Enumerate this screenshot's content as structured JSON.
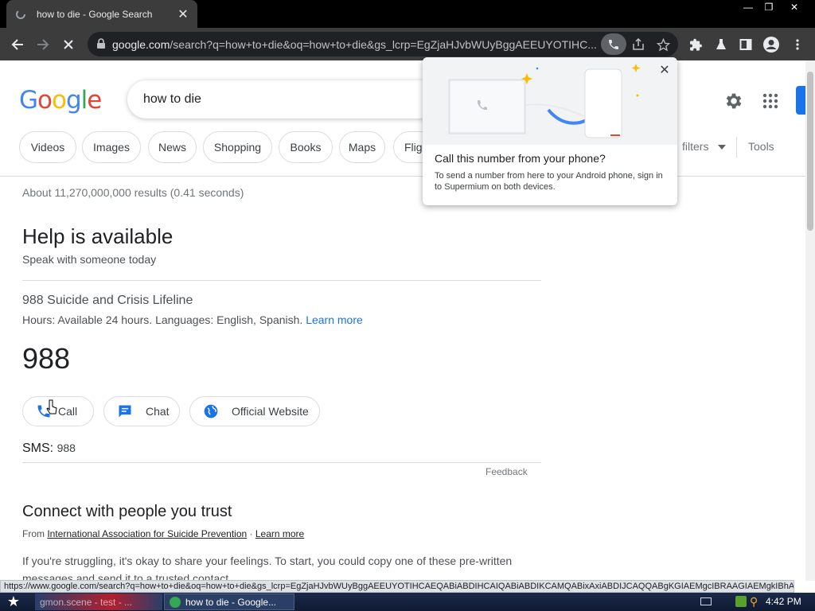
{
  "browser": {
    "tab_title": "how to die - Google Search",
    "tab_close": "✕",
    "url_host": "google.com",
    "url_rest": "/search?q=how+to+die&oq=how+to+die&gs_lcrp=EgZjaHJvbWUyBggAEEUYOTIHC...",
    "win_min": "—",
    "win_max": "❐",
    "win_close": "✕"
  },
  "google": {
    "logo_letters": [
      "G",
      "o",
      "o",
      "g",
      "l",
      "e"
    ],
    "logo_colors": [
      "#4285f4",
      "#ea4335",
      "#fbbc05",
      "#4285f4",
      "#34a853",
      "#ea4335"
    ],
    "query": "how to die",
    "chips": [
      "Videos",
      "Images",
      "News",
      "Shopping",
      "Books",
      "Maps",
      "Flig"
    ],
    "filters": "filters",
    "tools": "Tools"
  },
  "results": {
    "stats": "About 11,270,000,000 results (0.41 seconds)",
    "help_title": "Help is available",
    "help_sub": "Speak with someone today",
    "lifeline_name": "988 Suicide and Crisis Lifeline",
    "hours_text": "Hours: Available 24 hours. Languages: English, Spanish.",
    "learn_more": "Learn more",
    "number": "988",
    "buttons": {
      "call": "Call",
      "chat": "Chat",
      "website": "Official Website"
    },
    "sms_label": "SMS:",
    "sms_number": "988",
    "feedback": "Feedback",
    "connect_title": "Connect with people you trust",
    "from_label": "From",
    "from_org": "International Association for Suicide Prevention",
    "from_sep": "·",
    "from_learn": "Learn more",
    "struggle_text": "If you're struggling, it's okay to share your feelings. To start, you could copy one of these pre-written messages and send it to a trusted contact."
  },
  "popup": {
    "title": "Call this number from your phone?",
    "body": "To send a number from here to your Android phone, sign in to Supermium on both devices.",
    "close": "✕"
  },
  "status_url": "https://www.google.com/search?q=how+to+die&oq=how+to+die&gs_lcrp=EgZjaHJvbWUyBggAEEUYOTIHCAEQABiABDIHCAIQABiABDIKCAMQABixAxiABDIJCAQQABgKGIAEMgcIBRAAGIAEMgkIBhAAGA...",
  "taskbar": {
    "task1": "gmon.scene - test - ...",
    "task2": "how to die - Google...",
    "clock": "4:42 PM"
  },
  "colors": {
    "link": "#1a73e8",
    "chrome_dark": "#3c3c3c",
    "accent_blue": "#1a73e8"
  }
}
